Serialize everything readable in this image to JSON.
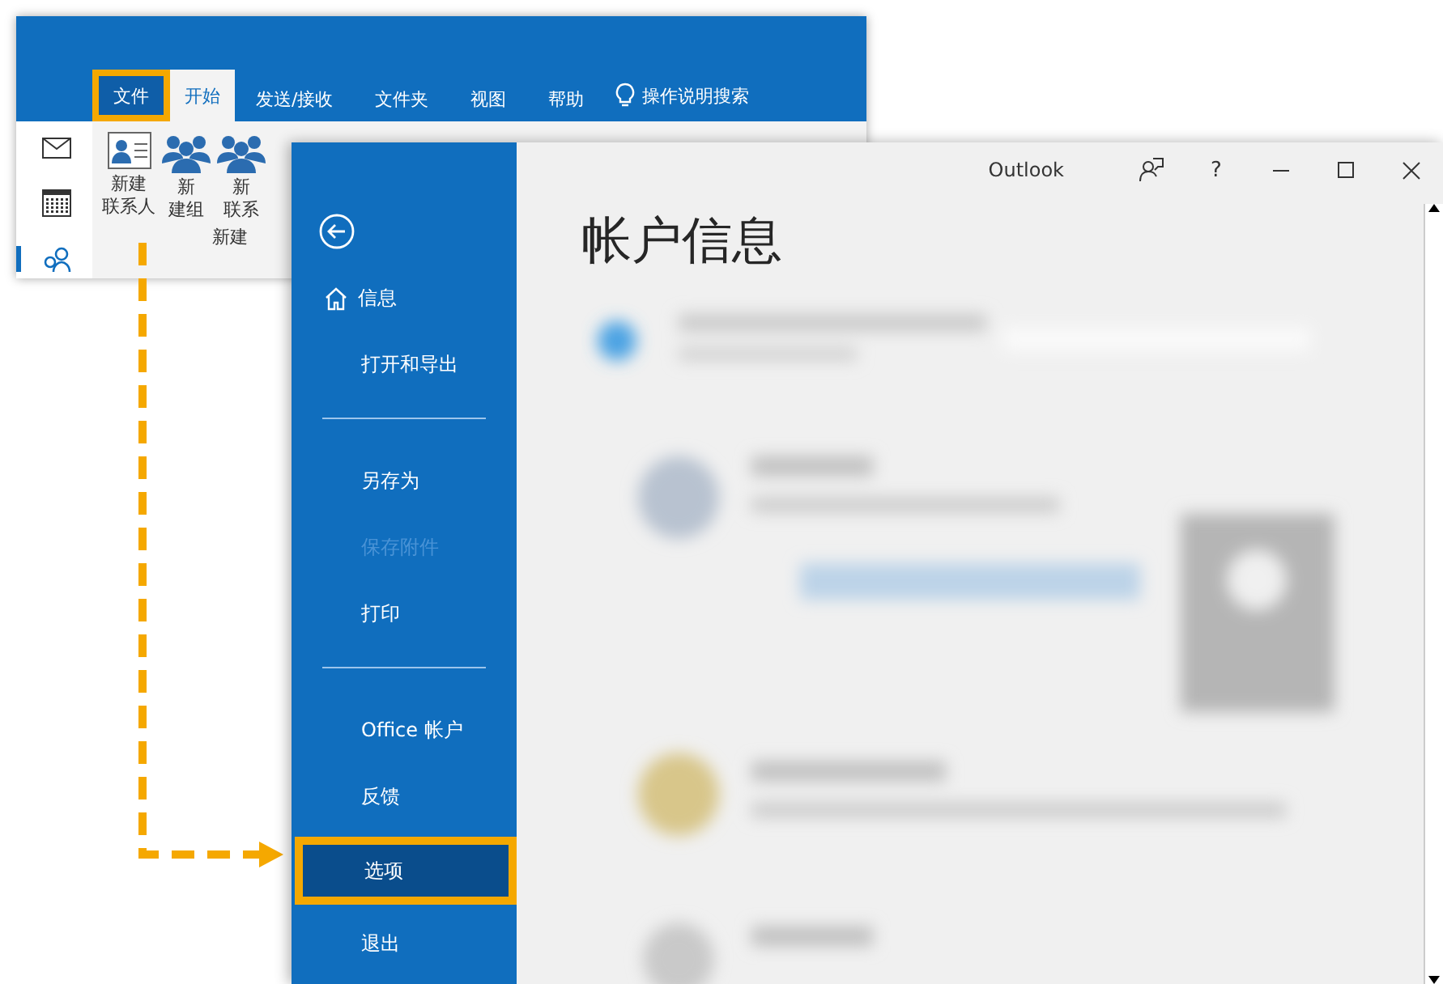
{
  "back_window": {
    "nav": [
      {
        "kind": "mail",
        "selected": false
      },
      {
        "kind": "calendar",
        "selected": false
      },
      {
        "kind": "people",
        "selected": true
      }
    ],
    "tabs": [
      {
        "label": "文件",
        "selected": false,
        "highlighted": true
      },
      {
        "label": "开始",
        "selected": true,
        "highlighted": false
      },
      {
        "label": "发送/接收",
        "selected": false,
        "highlighted": false
      },
      {
        "label": "文件夹",
        "selected": false,
        "highlighted": false
      },
      {
        "label": "视图",
        "selected": false,
        "highlighted": false
      },
      {
        "label": "帮助",
        "selected": false,
        "highlighted": false
      }
    ],
    "search": {
      "label": "操作说明搜索"
    },
    "ribbon_buttons": [
      {
        "kind": "contact",
        "lines": [
          "新建",
          "联系人"
        ]
      },
      {
        "kind": "group",
        "lines": [
          "新",
          "建组"
        ]
      },
      {
        "kind": "group",
        "lines": [
          "新",
          "联系"
        ]
      }
    ],
    "group_label": "新建"
  },
  "front_window": {
    "app_name": "Outlook",
    "help": "?",
    "nav": [
      {
        "kind": "home",
        "label": "信息",
        "disabled": false,
        "highlighted": false
      },
      {
        "kind": "item",
        "label": "打开和导出",
        "disabled": false,
        "highlighted": false
      },
      {
        "kind": "divider"
      },
      {
        "kind": "item",
        "label": "另存为",
        "disabled": false,
        "highlighted": false
      },
      {
        "kind": "item",
        "label": "保存附件",
        "disabled": true,
        "highlighted": false
      },
      {
        "kind": "item",
        "label": "打印",
        "disabled": false,
        "highlighted": false
      },
      {
        "kind": "divider"
      },
      {
        "kind": "item",
        "label": "Office 帐户",
        "disabled": false,
        "highlighted": false
      },
      {
        "kind": "item",
        "label": "反馈",
        "disabled": false,
        "highlighted": false
      },
      {
        "kind": "item",
        "label": "选项",
        "disabled": false,
        "highlighted": true
      },
      {
        "kind": "item",
        "label": "退出",
        "disabled": false,
        "highlighted": false
      }
    ],
    "heading": "帐户信息"
  }
}
